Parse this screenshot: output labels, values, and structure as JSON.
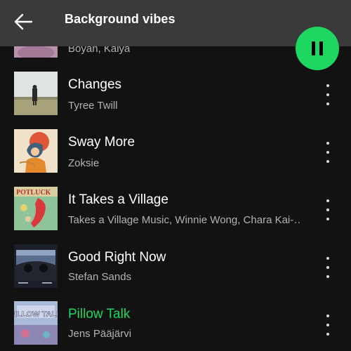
{
  "header": {
    "title": "Background vibes",
    "back_icon": "arrow-left-icon",
    "play_state": "playing",
    "play_button_icon": "pause-icon",
    "accent_color": "#1ed760"
  },
  "tracks": [
    {
      "title": "",
      "artist": "Boyan, Kalya",
      "now_playing": false
    },
    {
      "title": "Changes",
      "artist": "Tyree Twill",
      "now_playing": false
    },
    {
      "title": "Sway More",
      "artist": "Zoksie",
      "now_playing": false
    },
    {
      "title": "It Takes a Village",
      "artist": "Takes a Village Music, Winnie Wong, Chara Kai-…",
      "now_playing": false,
      "cover_text": "POTLUCK"
    },
    {
      "title": "Good Right Now",
      "artist": "Stefan Sands",
      "now_playing": false
    },
    {
      "title": "Pillow Talk",
      "artist": "Jens Pääjärvi",
      "now_playing": true,
      "cover_text": "PILLOW TALK"
    }
  ],
  "more_icon": "more-vertical-icon"
}
